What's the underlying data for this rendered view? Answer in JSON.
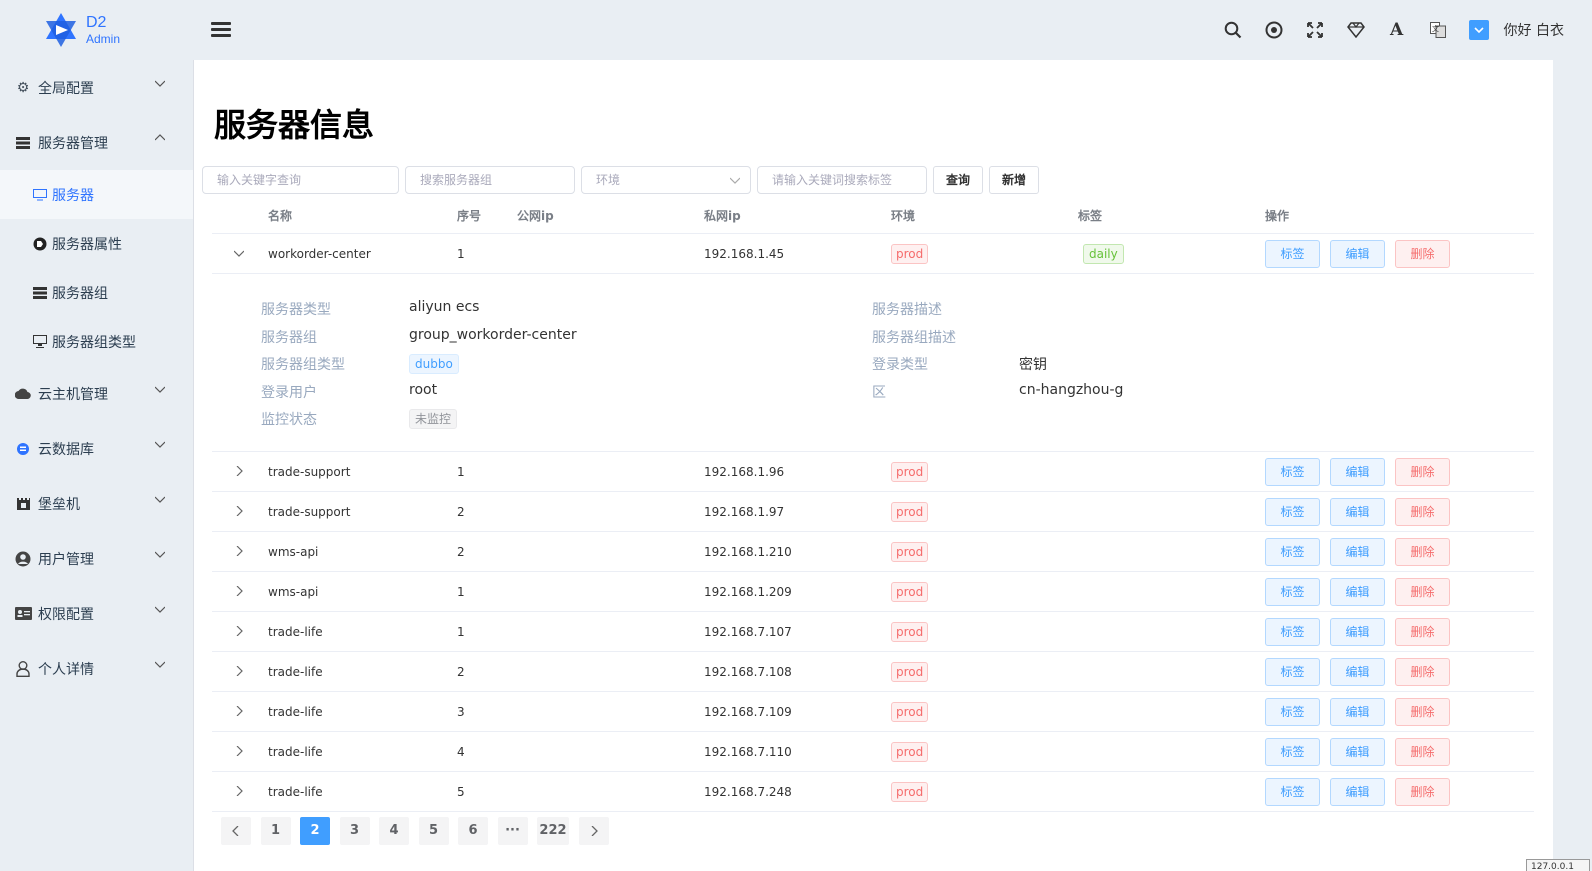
{
  "brand": {
    "title": "D2",
    "subtitle": "Admin"
  },
  "sidebar": {
    "items": [
      {
        "label": "全局配置",
        "icon": "gears-icon",
        "expanded": false
      },
      {
        "label": "服务器管理",
        "icon": "server-stack-icon",
        "expanded": true,
        "children": [
          {
            "label": "服务器",
            "icon": "monitor-icon",
            "active": true
          },
          {
            "label": "服务器属性",
            "icon": "tag-circle-icon"
          },
          {
            "label": "服务器组",
            "icon": "server-stack-icon"
          },
          {
            "label": "服务器组类型",
            "icon": "desktop-icon"
          }
        ]
      },
      {
        "label": "云主机管理",
        "icon": "cloud-icon",
        "expanded": false
      },
      {
        "label": "云数据库",
        "icon": "database-icon",
        "expanded": false
      },
      {
        "label": "堡垒机",
        "icon": "castle-icon",
        "expanded": false
      },
      {
        "label": "用户管理",
        "icon": "user-circle-icon",
        "expanded": false
      },
      {
        "label": "权限配置",
        "icon": "id-card-icon",
        "expanded": false
      },
      {
        "label": "个人详情",
        "icon": "user-icon",
        "expanded": false
      }
    ]
  },
  "header": {
    "greeting": "你好 白衣"
  },
  "page": {
    "title": "服务器信息"
  },
  "search": {
    "keyword_placeholder": "输入关键字查询",
    "group_placeholder": "搜索服务器组",
    "env_placeholder": "环境",
    "tag_placeholder": "请输入关键词搜索标签",
    "query_label": "查询",
    "add_label": "新增"
  },
  "table": {
    "headers": [
      "名称",
      "序号",
      "公网ip",
      "私网ip",
      "环境",
      "标签",
      "操作"
    ],
    "actions": {
      "tag": "标签",
      "edit": "编辑",
      "delete": "删除"
    },
    "expanded_row": {
      "name": "workorder-center",
      "seq": "1",
      "public_ip": "",
      "private_ip": "192.168.1.45",
      "env": "prod",
      "tag": "daily",
      "detail": {
        "server_type_label": "服务器类型",
        "server_type": "aliyun ecs",
        "server_desc_label": "服务器描述",
        "server_desc": "",
        "group_label": "服务器组",
        "group": "group_workorder-center",
        "group_desc_label": "服务器组描述",
        "group_desc": "",
        "group_type_label": "服务器组类型",
        "group_type": "dubbo",
        "login_type_label": "登录类型",
        "login_type": "密钥",
        "login_user_label": "登录用户",
        "login_user": "root",
        "zone_label": "区",
        "zone": "cn-hangzhou-g",
        "monitor_label": "监控状态",
        "monitor": "未监控"
      }
    },
    "rows": [
      {
        "name": "trade-support",
        "seq": "1",
        "private_ip": "192.168.1.96",
        "env": "prod"
      },
      {
        "name": "trade-support",
        "seq": "2",
        "private_ip": "192.168.1.97",
        "env": "prod"
      },
      {
        "name": "wms-api",
        "seq": "2",
        "private_ip": "192.168.1.210",
        "env": "prod"
      },
      {
        "name": "wms-api",
        "seq": "1",
        "private_ip": "192.168.1.209",
        "env": "prod"
      },
      {
        "name": "trade-life",
        "seq": "1",
        "private_ip": "192.168.7.107",
        "env": "prod"
      },
      {
        "name": "trade-life",
        "seq": "2",
        "private_ip": "192.168.7.108",
        "env": "prod"
      },
      {
        "name": "trade-life",
        "seq": "3",
        "private_ip": "192.168.7.109",
        "env": "prod"
      },
      {
        "name": "trade-life",
        "seq": "4",
        "private_ip": "192.168.7.110",
        "env": "prod"
      },
      {
        "name": "trade-life",
        "seq": "5",
        "private_ip": "192.168.7.248",
        "env": "prod"
      }
    ]
  },
  "pagination": {
    "pages": [
      "1",
      "2",
      "3",
      "4",
      "5",
      "6",
      "···",
      "222"
    ],
    "current": "2"
  },
  "footer": {
    "ip": "127.0.0.1"
  },
  "colors": {
    "accent": "#409eff",
    "brand": "#2f74ff",
    "danger": "#f56c6c",
    "success": "#67c23a",
    "sidebar_bg": "#e9eef3"
  }
}
